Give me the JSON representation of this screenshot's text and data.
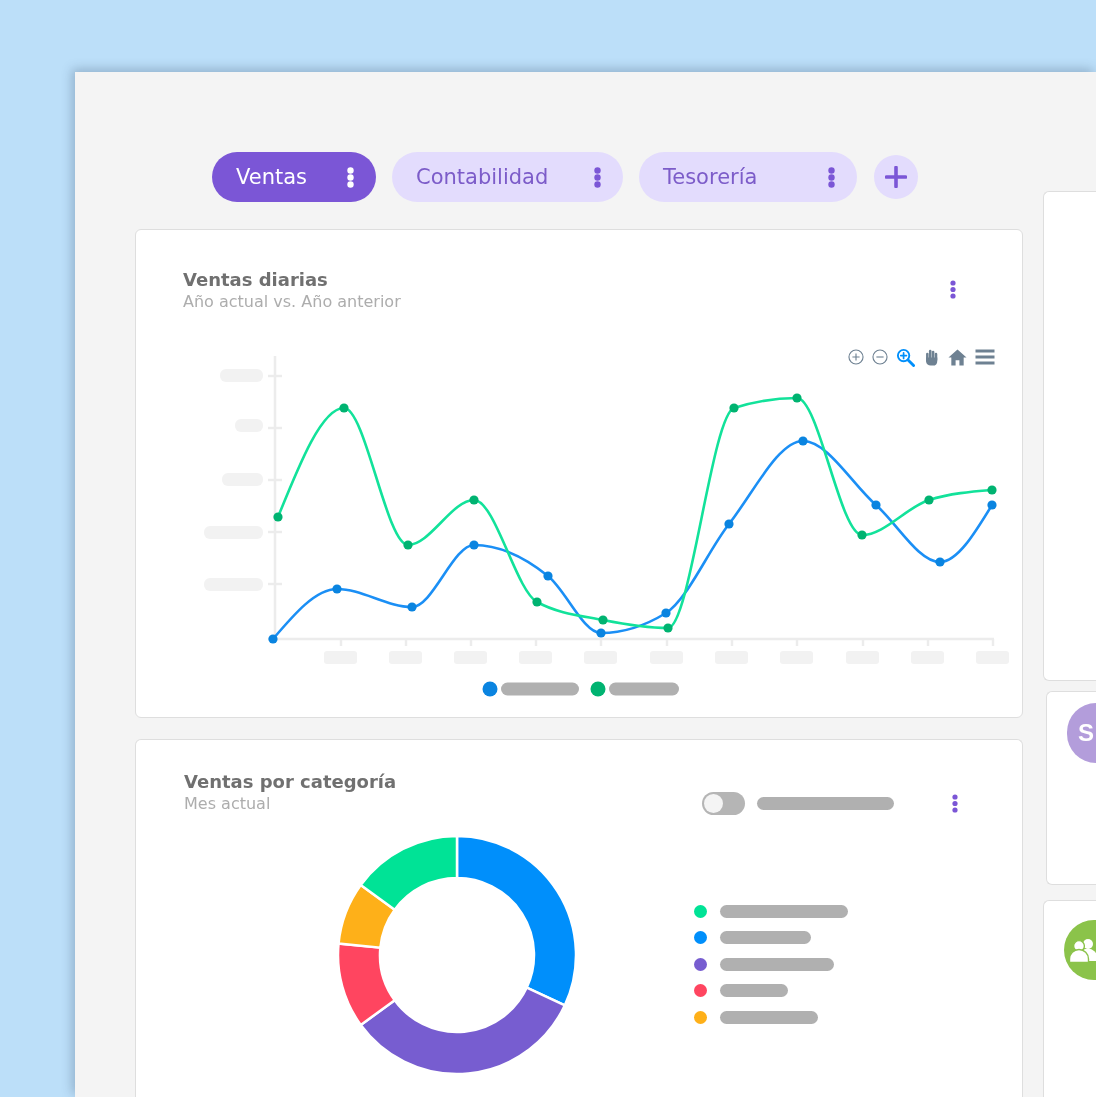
{
  "tabs": [
    {
      "label": "Ventas",
      "selected": true
    },
    {
      "label": "Contabilidad",
      "selected": false
    },
    {
      "label": "Tesorería",
      "selected": false
    }
  ],
  "daily_sales_card": {
    "title": "Ventas diarias",
    "subtitle": "Año actual vs. Año anterior",
    "toolbar": [
      {
        "kind": "zoom_in",
        "selected": false
      },
      {
        "kind": "zoom_out",
        "selected": false
      },
      {
        "kind": "selection_zoom",
        "selected": true
      },
      {
        "kind": "pan",
        "selected": false
      },
      {
        "kind": "reset",
        "selected": false
      },
      {
        "kind": "menu",
        "selected": false
      }
    ],
    "legend": [
      {
        "color": "#0a84e0"
      },
      {
        "color": "#00b371"
      }
    ]
  },
  "category_card": {
    "title": "Ventas por categoría",
    "subtitle": "Mes actual",
    "toggle": {
      "on": false
    },
    "legend": [
      {
        "color": "#00e396"
      },
      {
        "color": "#008ffb"
      },
      {
        "color": "#775dd0"
      },
      {
        "color": "#ff4560"
      },
      {
        "color": "#feb019"
      }
    ]
  },
  "side_cards": [
    {
      "kind": "blank"
    },
    {
      "kind": "avatar",
      "initial": "S"
    },
    {
      "kind": "users"
    }
  ]
}
